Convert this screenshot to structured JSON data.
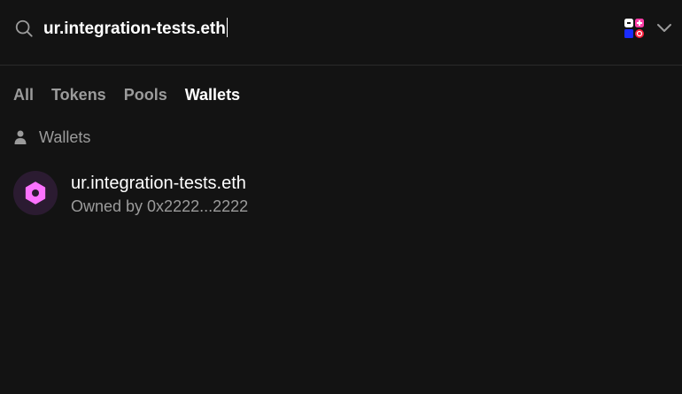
{
  "search": {
    "value": "ur.integration-tests.eth",
    "placeholder": ""
  },
  "icons": {
    "search": "search-icon",
    "chain_selector": "multi-chain-icon",
    "chevron": "chevron-down-icon",
    "section_user": "user-icon",
    "wallet_avatar": "hexagon-icon"
  },
  "tabs": [
    {
      "label": "All",
      "active": false
    },
    {
      "label": "Tokens",
      "active": false
    },
    {
      "label": "Pools",
      "active": false
    },
    {
      "label": "Wallets",
      "active": true
    }
  ],
  "section": {
    "label": "Wallets"
  },
  "results": [
    {
      "name": "ur.integration-tests.eth",
      "owner": "Owned by 0x2222...2222"
    }
  ],
  "colors": {
    "background": "#131313",
    "muted_text": "#9b9b9b",
    "accent_pink": "#fc72ff",
    "avatar_bg": "#2b1b31"
  }
}
